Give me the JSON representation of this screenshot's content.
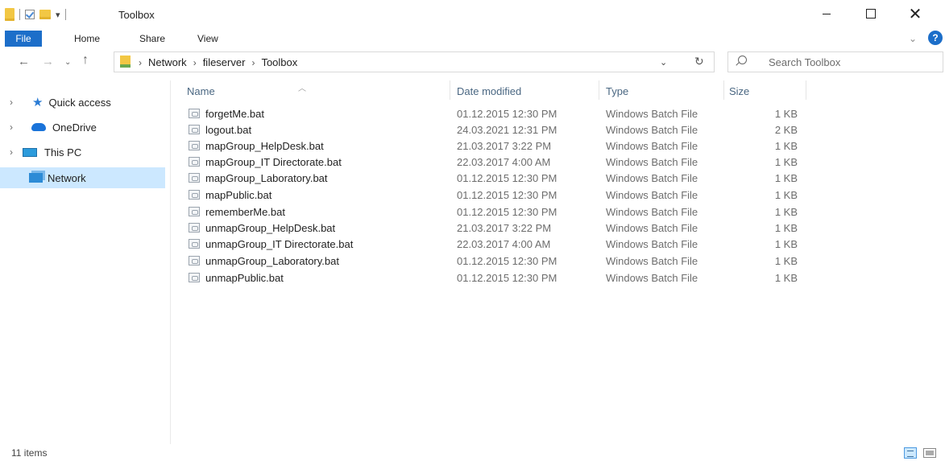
{
  "window": {
    "title": "Toolbox"
  },
  "ribbon": {
    "tabs": [
      "File",
      "Home",
      "Share",
      "View"
    ],
    "help": "?"
  },
  "address": {
    "crumbs": [
      "Network",
      "fileserver",
      "Toolbox"
    ],
    "search_placeholder": "Search Toolbox"
  },
  "sidebar": {
    "items": [
      {
        "label": "Quick access",
        "icon": "star-icon"
      },
      {
        "label": "OneDrive",
        "icon": "cloud-icon"
      },
      {
        "label": "This PC",
        "icon": "computer-icon"
      },
      {
        "label": "Network",
        "icon": "network-icon",
        "selected": true
      }
    ]
  },
  "columns": {
    "name": "Name",
    "date": "Date modified",
    "type": "Type",
    "size": "Size"
  },
  "files": [
    {
      "name": "forgetMe.bat",
      "date": "01.12.2015 12:30 PM",
      "type": "Windows Batch File",
      "size": "1 KB"
    },
    {
      "name": "logout.bat",
      "date": "24.03.2021 12:31 PM",
      "type": "Windows Batch File",
      "size": "2 KB"
    },
    {
      "name": "mapGroup_HelpDesk.bat",
      "date": "21.03.2017 3:22 PM",
      "type": "Windows Batch File",
      "size": "1 KB"
    },
    {
      "name": "mapGroup_IT Directorate.bat",
      "date": "22.03.2017 4:00 AM",
      "type": "Windows Batch File",
      "size": "1 KB"
    },
    {
      "name": "mapGroup_Laboratory.bat",
      "date": "01.12.2015 12:30 PM",
      "type": "Windows Batch File",
      "size": "1 KB"
    },
    {
      "name": "mapPublic.bat",
      "date": "01.12.2015 12:30 PM",
      "type": "Windows Batch File",
      "size": "1 KB"
    },
    {
      "name": "rememberMe.bat",
      "date": "01.12.2015 12:30 PM",
      "type": "Windows Batch File",
      "size": "1 KB"
    },
    {
      "name": "unmapGroup_HelpDesk.bat",
      "date": "21.03.2017 3:22 PM",
      "type": "Windows Batch File",
      "size": "1 KB"
    },
    {
      "name": "unmapGroup_IT Directorate.bat",
      "date": "22.03.2017 4:00 AM",
      "type": "Windows Batch File",
      "size": "1 KB"
    },
    {
      "name": "unmapGroup_Laboratory.bat",
      "date": "01.12.2015 12:30 PM",
      "type": "Windows Batch File",
      "size": "1 KB"
    },
    {
      "name": "unmapPublic.bat",
      "date": "01.12.2015 12:30 PM",
      "type": "Windows Batch File",
      "size": "1 KB"
    }
  ],
  "status": {
    "items": "11 items"
  }
}
